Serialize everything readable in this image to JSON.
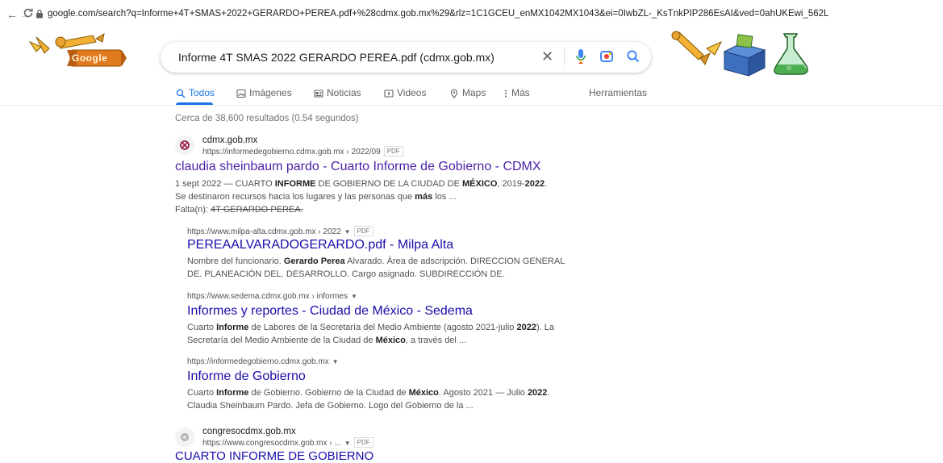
{
  "browser": {
    "url": "google.com/search?q=Informe+4T+SMAS+2022+GERARDO+PEREA.pdf+%28cdmx.gob.mx%29&rlz=1C1GCEU_enMX1042MX1043&ei=0IwbZL-_KsTnkPIP286EsAI&ved=0ahUKEwi_562L",
    "back_icon": "arrow-left-icon",
    "forward_icon": "arrow-right-icon",
    "reload_icon": "reload-icon"
  },
  "header": {
    "logo_text": "Google",
    "search_value": "Informe 4T SMAS 2022 GERARDO PEREA.pdf (cdmx.gob.mx)",
    "accent": "#1a73e8"
  },
  "tabs": [
    {
      "label": "Todos",
      "icon": "search-icon",
      "active": true
    },
    {
      "label": "Imágenes",
      "icon": "image-icon"
    },
    {
      "label": "Noticias",
      "icon": "news-icon"
    },
    {
      "label": "Videos",
      "icon": "play-icon"
    },
    {
      "label": "Maps",
      "icon": "map-pin-icon"
    },
    {
      "label": "Más",
      "icon": "more-vert-icon"
    },
    {
      "label": "Herramientas"
    }
  ],
  "stats": "Cerca de 38,600 resultados (0.54 segundos)",
  "results": {
    "r1": {
      "site": "cdmx.gob.mx",
      "url": "https://informedegobierno.cdmx.gob.mx › 2022/09",
      "badge": "PDF",
      "title": "claudia sheinbaum pardo - Cuarto Informe de Gobierno - CDMX",
      "snippet1_pre": "1 sept 2022 — CUARTO ",
      "snippet1_b1": "INFORME",
      "snippet1_mid": " DE GOBIERNO DE LA CIUDAD DE ",
      "snippet1_b2": "MÉXICO",
      "snippet1_mid2": ", 2019-",
      "snippet1_b3": "2022",
      "snippet1_end": ".",
      "snippet2_pre": "Se destinaron recursos hacia los lugares y las personas que ",
      "snippet2_b": "más",
      "snippet2_end": " los ...",
      "missing_label": "Falta(n): ",
      "missing_terms": "4T GERARDO PEREA."
    },
    "r2": {
      "url": "https://www.milpa-alta.cdmx.gob.mx › 2022",
      "badge": "PDF",
      "title": "PEREAALVARADOGERARDO.pdf - Milpa Alta",
      "s1_pre": "Nombre del funcionario. ",
      "s1_b": "Gerardo Perea",
      "s1_end": " Alvarado. Área de adscripción. DIRECCION GENERAL",
      "s2": "DE. PLANEACIÓN DEL. DESARROLLO. Cargo asignado. SUBDIRECCIÓN DE."
    },
    "r3": {
      "url": "https://www.sedema.cdmx.gob.mx › informes",
      "title": "Informes y reportes - Ciudad de México - Sedema",
      "s1_pre": "Cuarto ",
      "s1_b1": "Informe",
      "s1_mid": " de Labores de la Secretaría del Medio Ambiente (agosto 2021-julio ",
      "s1_b2": "2022",
      "s1_end": "). La",
      "s2_pre": "Secretaría del Medio Ambiente de la Ciudad de ",
      "s2_b": "México",
      "s2_end": ", a través del ..."
    },
    "r4": {
      "url": "https://informedegobierno.cdmx.gob.mx",
      "title": "Informe de Gobierno",
      "s1_pre": "Cuarto ",
      "s1_b1": "Informe",
      "s1_mid": " de Gobierno. Gobierno de la Ciudad de ",
      "s1_b2": "México",
      "s1_mid2": ". Agosto 2021 — Julio ",
      "s1_b3": "2022",
      "s1_end": ".",
      "s2": "Claudia Sheinbaum Pardo. Jefa de Gobierno. Logo del Gobierno de la ..."
    },
    "r5": {
      "site": "congresocdmx.gob.mx",
      "url": "https://www.congresocdmx.gob.mx › ...",
      "badge": "PDF",
      "title": "CUARTO INFORME DE GOBIERNO"
    }
  }
}
